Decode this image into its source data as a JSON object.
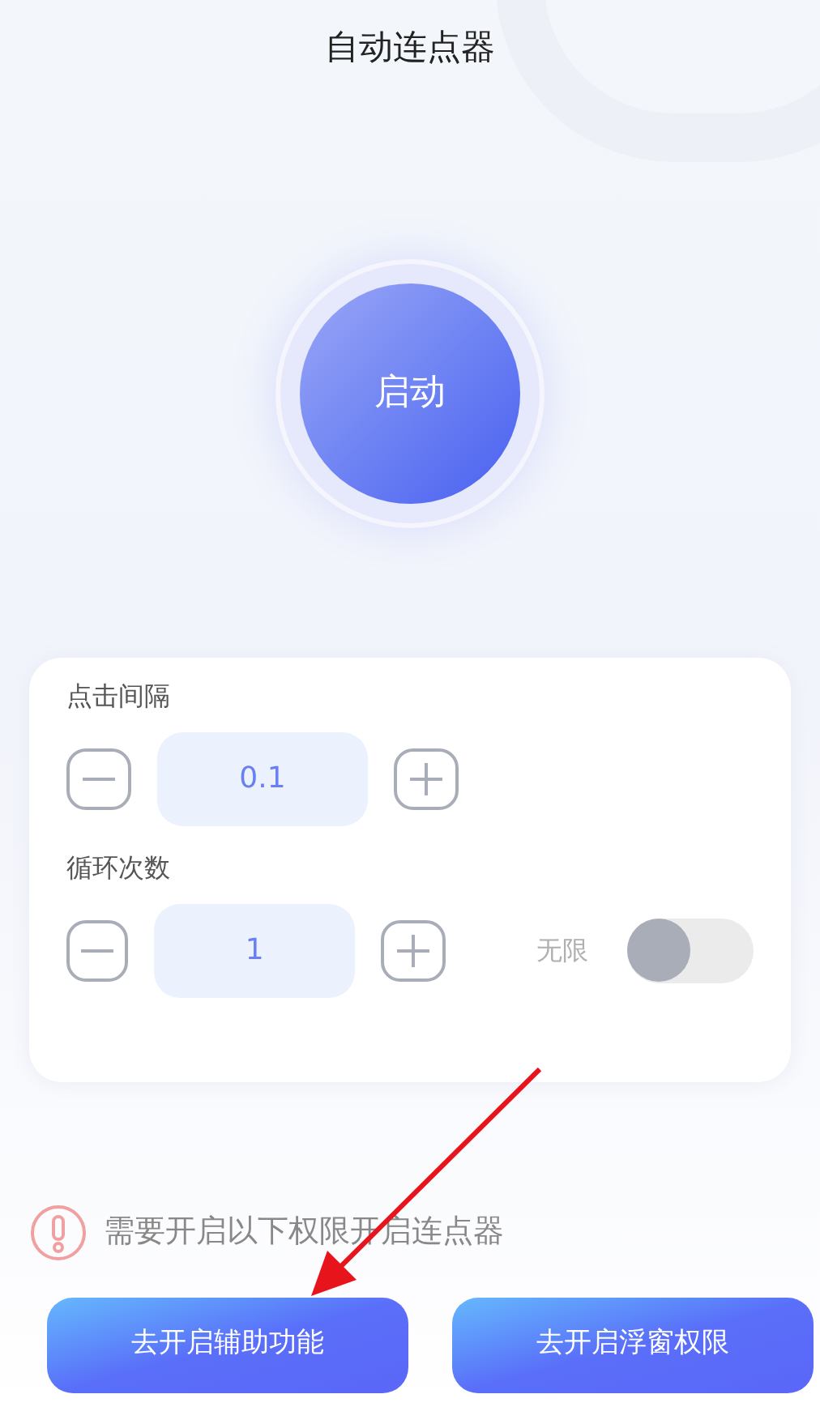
{
  "title": "自动连点器",
  "start_button": {
    "label": "启动"
  },
  "settings": [
    {
      "label": "点击间隔",
      "value": "0.1"
    },
    {
      "label": "循环次数",
      "value": "1",
      "toggle": {
        "label": "无限",
        "on": false
      }
    }
  ],
  "notice": "需要开启以下权限开启连点器",
  "buttons": [
    "去开启辅助功能",
    "去开启浮窗权限"
  ]
}
